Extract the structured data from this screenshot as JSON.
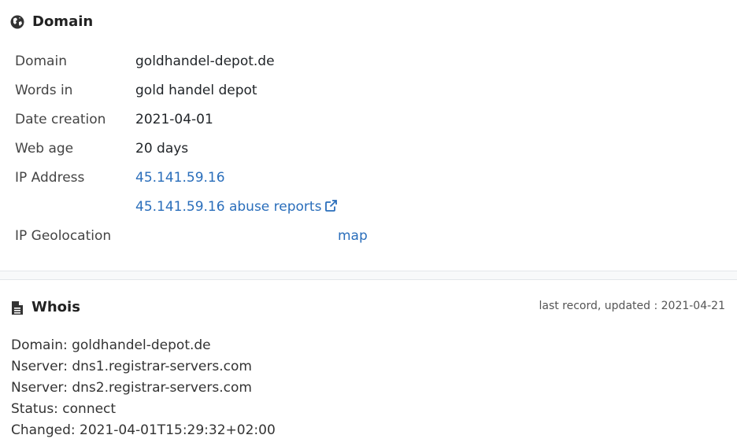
{
  "domain_section": {
    "title": "Domain",
    "rows": {
      "domain": {
        "label": "Domain",
        "value": "goldhandel-depot.de"
      },
      "words": {
        "label": "Words in",
        "value": "gold handel depot"
      },
      "creation": {
        "label": "Date creation",
        "value": "2021-04-01"
      },
      "age": {
        "label": "Web age",
        "value": "20 days"
      },
      "ip": {
        "label": "IP Address",
        "value": "45.141.59.16"
      },
      "abuse": {
        "value": "45.141.59.16 abuse reports"
      },
      "geo": {
        "label": "IP Geolocation",
        "value": "map"
      }
    }
  },
  "whois_section": {
    "title": "Whois",
    "updated": "last record, updated : 2021-04-21",
    "lines": [
      "Domain: goldhandel-depot.de",
      "Nserver: dns1.registrar-servers.com",
      "Nserver: dns2.registrar-servers.com",
      "Status: connect",
      "Changed: 2021-04-01T15:29:32+02:00"
    ]
  },
  "icons": {
    "domain": "globe-icon",
    "whois": "document-icon",
    "external": "external-link-icon"
  },
  "colors": {
    "link": "#2a6ebb",
    "text": "#212529",
    "label": "#444444"
  }
}
